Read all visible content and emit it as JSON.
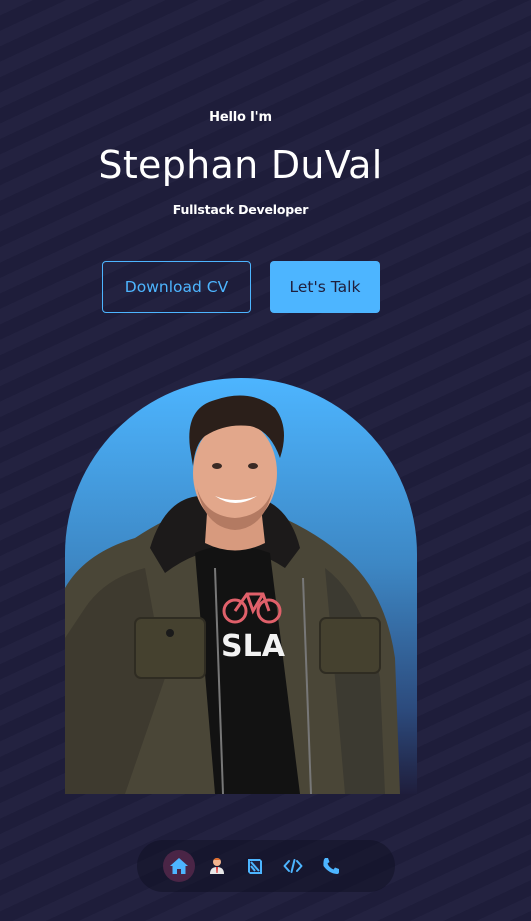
{
  "hero": {
    "greeting": "Hello I'm",
    "name": "Stephan DuVal",
    "role": "Fullstack Developer"
  },
  "buttons": {
    "download_cv": "Download CV",
    "lets_talk": "Let's Talk"
  },
  "portrait": {
    "shirt_text": "SLA"
  },
  "nav": {
    "items": [
      {
        "icon": "home-icon",
        "active": true
      },
      {
        "icon": "user-icon",
        "active": false
      },
      {
        "icon": "book-icon",
        "active": false
      },
      {
        "icon": "code-icon",
        "active": false
      },
      {
        "icon": "phone-icon",
        "active": false
      }
    ]
  },
  "colors": {
    "background": "#1f1e3c",
    "accent": "#4db5ff",
    "nav_active": "#4a2546"
  }
}
